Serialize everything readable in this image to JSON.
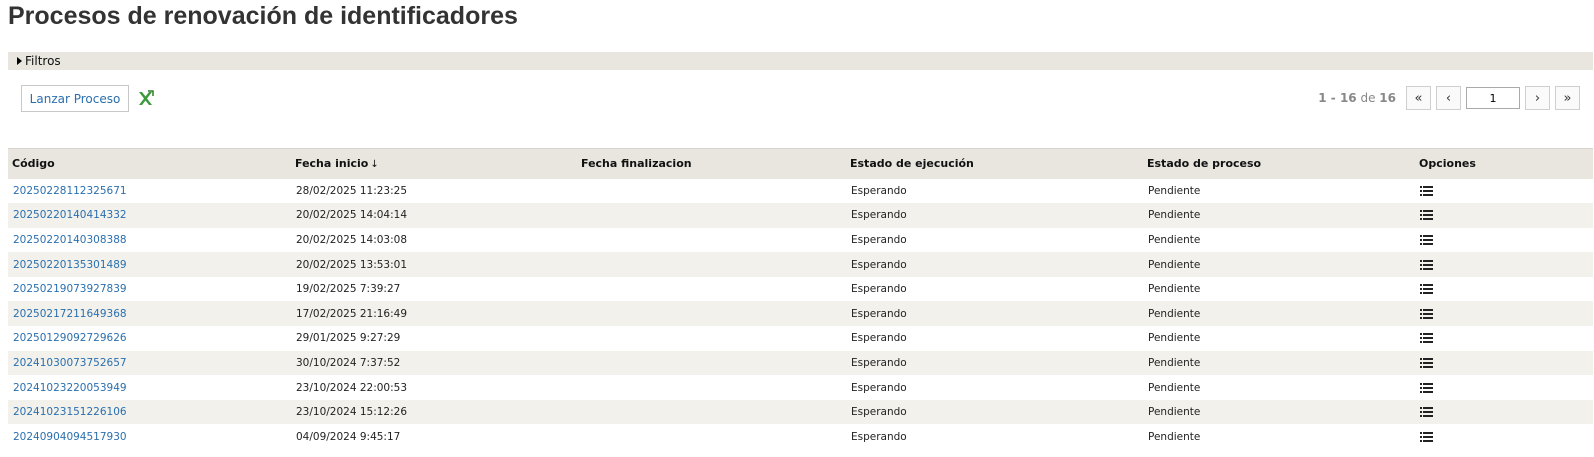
{
  "page": {
    "title": "Procesos de renovación de identificadores"
  },
  "filters": {
    "label": "Filtros"
  },
  "toolbar": {
    "launch_label": "Lanzar Proceso",
    "export_icon": "excel-export-icon"
  },
  "pager": {
    "range_start": "1",
    "range_sep": " - ",
    "range_end": "16",
    "of_label": " de ",
    "total": "16",
    "first": "«",
    "prev": "‹",
    "page": "1",
    "next": "›",
    "last": "»"
  },
  "table": {
    "columns": [
      "Código",
      "Fecha inicio",
      "Fecha finalizacion",
      "Estado de ejecución",
      "Estado de proceso",
      "Opciones"
    ],
    "sort_indicator": "↓",
    "rows": [
      {
        "code": "20250228112325671",
        "start": "28/02/2025 11:23:25",
        "end": "",
        "exec": "Esperando",
        "status": "Pendiente"
      },
      {
        "code": "20250220140414332",
        "start": "20/02/2025 14:04:14",
        "end": "",
        "exec": "Esperando",
        "status": "Pendiente"
      },
      {
        "code": "20250220140308388",
        "start": "20/02/2025 14:03:08",
        "end": "",
        "exec": "Esperando",
        "status": "Pendiente"
      },
      {
        "code": "20250220135301489",
        "start": "20/02/2025 13:53:01",
        "end": "",
        "exec": "Esperando",
        "status": "Pendiente"
      },
      {
        "code": "20250219073927839",
        "start": "19/02/2025 7:39:27",
        "end": "",
        "exec": "Esperando",
        "status": "Pendiente"
      },
      {
        "code": "20250217211649368",
        "start": "17/02/2025 21:16:49",
        "end": "",
        "exec": "Esperando",
        "status": "Pendiente"
      },
      {
        "code": "20250129092729626",
        "start": "29/01/2025 9:27:29",
        "end": "",
        "exec": "Esperando",
        "status": "Pendiente"
      },
      {
        "code": "20241030073752657",
        "start": "30/10/2024 7:37:52",
        "end": "",
        "exec": "Esperando",
        "status": "Pendiente"
      },
      {
        "code": "20241023220053949",
        "start": "23/10/2024 22:00:53",
        "end": "",
        "exec": "Esperando",
        "status": "Pendiente"
      },
      {
        "code": "20241023151226106",
        "start": "23/10/2024 15:12:26",
        "end": "",
        "exec": "Esperando",
        "status": "Pendiente"
      },
      {
        "code": "20240904094517930",
        "start": "04/09/2024 9:45:17",
        "end": "",
        "exec": "Esperando",
        "status": "Pendiente"
      }
    ]
  },
  "colors": {
    "link": "#2a6fae",
    "header_bg": "#e8e6df",
    "row_alt": "#f2f1ec",
    "excel_green": "#3a9a3a"
  }
}
